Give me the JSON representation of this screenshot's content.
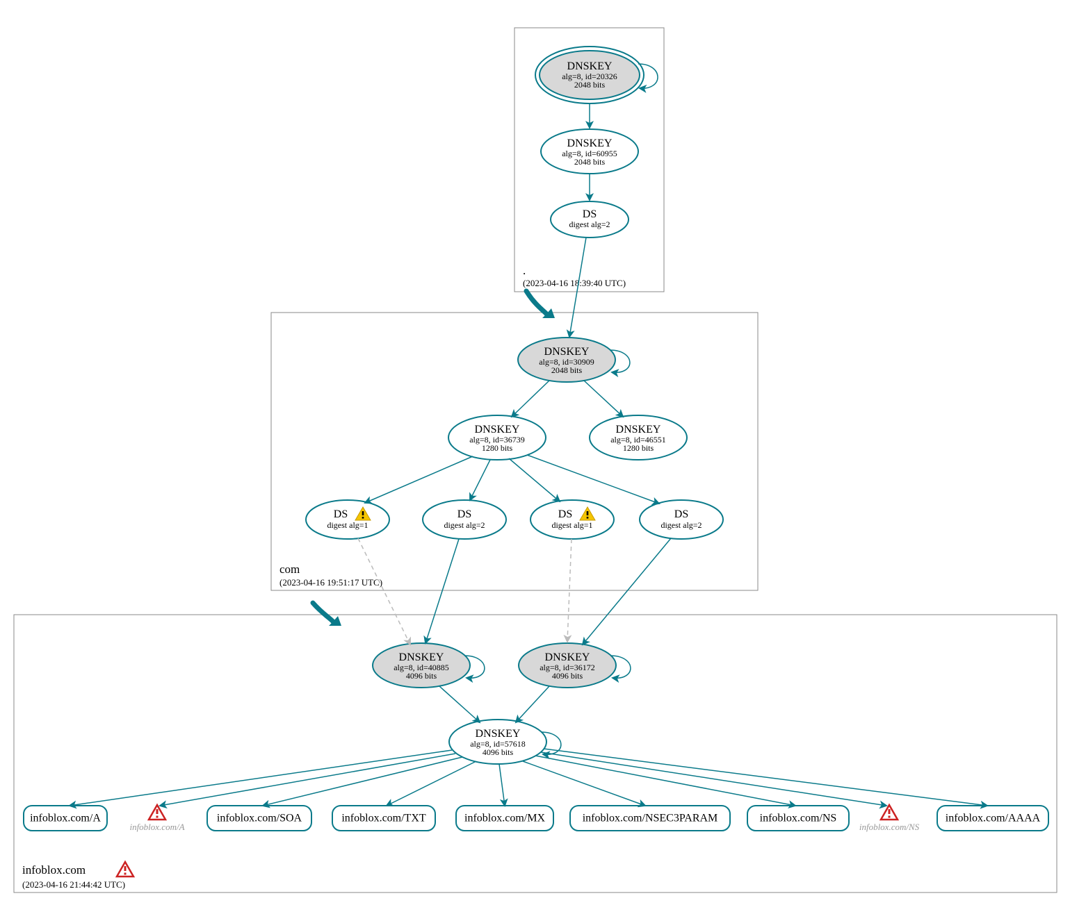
{
  "colors": {
    "teal": "#0a7a8a",
    "gray_fill": "#d8d8d8",
    "box_stroke": "#888888",
    "dashed_stroke": "#bbbbbb",
    "warn_yellow": "#f5c500",
    "error_red": "#cc2222"
  },
  "zones": {
    "root": {
      "label": ".",
      "timestamp": "(2023-04-16 18:39:40 UTC)"
    },
    "com": {
      "label": "com",
      "timestamp": "(2023-04-16 19:51:17 UTC)"
    },
    "infoblox": {
      "label": "infoblox.com",
      "timestamp": "(2023-04-16 21:44:42 UTC)"
    }
  },
  "nodes": {
    "root_ksk": {
      "title": "DNSKEY",
      "line2": "alg=8, id=20326",
      "line3": "2048 bits"
    },
    "root_zsk": {
      "title": "DNSKEY",
      "line2": "alg=8, id=60955",
      "line3": "2048 bits"
    },
    "root_ds": {
      "title": "DS",
      "line2": "digest alg=2",
      "line3": ""
    },
    "com_ksk": {
      "title": "DNSKEY",
      "line2": "alg=8, id=30909",
      "line3": "2048 bits"
    },
    "com_zsk1": {
      "title": "DNSKEY",
      "line2": "alg=8, id=36739",
      "line3": "1280 bits"
    },
    "com_zsk2": {
      "title": "DNSKEY",
      "line2": "alg=8, id=46551",
      "line3": "1280 bits"
    },
    "com_ds1": {
      "title": "DS",
      "line2": "digest alg=1",
      "line3": ""
    },
    "com_ds2": {
      "title": "DS",
      "line2": "digest alg=2",
      "line3": ""
    },
    "com_ds3": {
      "title": "DS",
      "line2": "digest alg=1",
      "line3": ""
    },
    "com_ds4": {
      "title": "DS",
      "line2": "digest alg=2",
      "line3": ""
    },
    "ib_ksk1": {
      "title": "DNSKEY",
      "line2": "alg=8, id=40885",
      "line3": "4096 bits"
    },
    "ib_ksk2": {
      "title": "DNSKEY",
      "line2": "alg=8, id=36172",
      "line3": "4096 bits"
    },
    "ib_zsk": {
      "title": "DNSKEY",
      "line2": "alg=8, id=57618",
      "line3": "4096 bits"
    }
  },
  "rrsets": {
    "a": "infoblox.com/A",
    "a_warn": "infoblox.com/A",
    "soa": "infoblox.com/SOA",
    "txt": "infoblox.com/TXT",
    "mx": "infoblox.com/MX",
    "nsec3param": "infoblox.com/NSEC3PARAM",
    "ns": "infoblox.com/NS",
    "ns_warn": "infoblox.com/NS",
    "aaaa": "infoblox.com/AAAA"
  }
}
